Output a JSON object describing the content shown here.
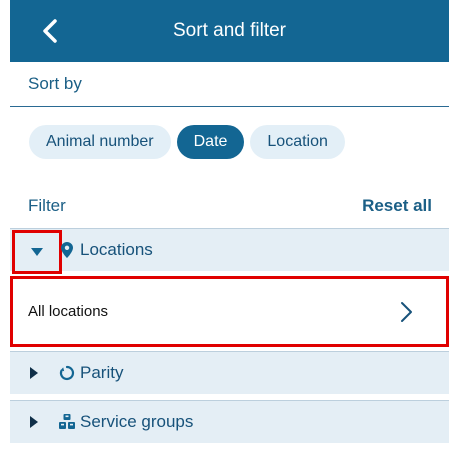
{
  "header": {
    "title": "Sort and filter",
    "back_icon": "chevron-left-icon"
  },
  "sort": {
    "label": "Sort by",
    "options": [
      {
        "label": "Animal number",
        "selected": false
      },
      {
        "label": "Date",
        "selected": true
      },
      {
        "label": "Location",
        "selected": false
      }
    ]
  },
  "filter": {
    "label": "Filter",
    "reset_label": "Reset all",
    "sections": [
      {
        "label": "Locations",
        "icon": "location-pin-icon",
        "expanded": true
      },
      {
        "label": "Parity",
        "icon": "parity-cycle-icon",
        "expanded": false
      },
      {
        "label": "Service groups",
        "icon": "service-groups-icon",
        "expanded": false
      }
    ],
    "locations_option": {
      "label": "All locations",
      "icon": "chevron-right-icon"
    }
  },
  "colors": {
    "primary": "#136693",
    "chip_bg": "#e3eff7",
    "row_bg": "#e4eef5",
    "highlight": "#e00000"
  }
}
